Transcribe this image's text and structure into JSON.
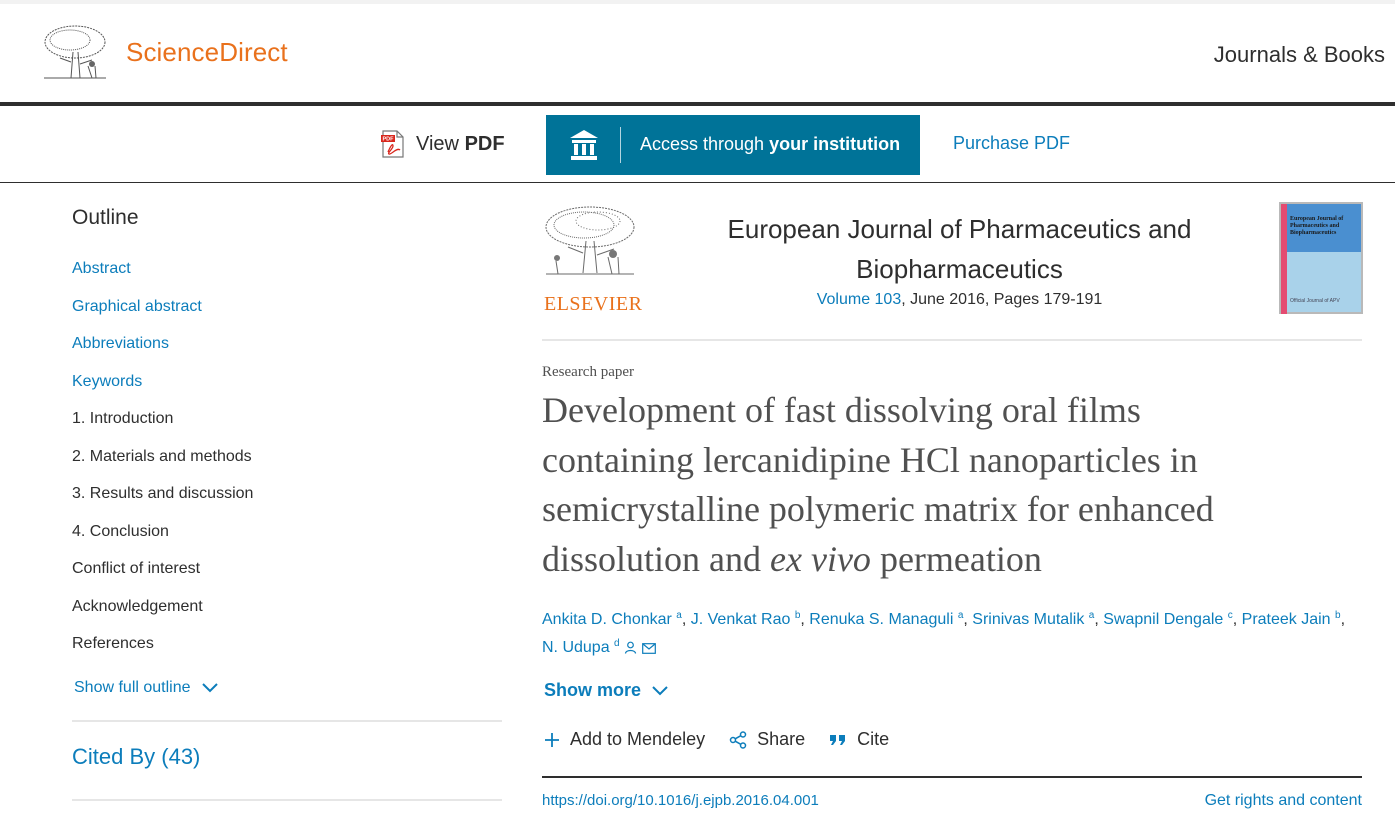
{
  "header": {
    "brand": "ScienceDirect",
    "journals_books": "Journals & Books",
    "brand_color": "#e9711c"
  },
  "toolbar": {
    "view_pdf_prefix": "View",
    "view_pdf_bold": "PDF",
    "access_prefix": "Access through",
    "access_bold": "your institution",
    "purchase": "Purchase PDF",
    "accent_color": "#007398"
  },
  "sidebar": {
    "outline_title": "Outline",
    "items": [
      {
        "label": "Abstract"
      },
      {
        "label": "Graphical abstract"
      },
      {
        "label": "Abbreviations"
      },
      {
        "label": "Keywords"
      },
      {
        "label": "1. Introduction"
      },
      {
        "label": "2. Materials and methods"
      },
      {
        "label": "3. Results and discussion"
      },
      {
        "label": "4. Conclusion"
      },
      {
        "label": "Conflict of interest"
      },
      {
        "label": "Acknowledgement"
      },
      {
        "label": "References"
      }
    ],
    "show_full_outline": "Show full outline",
    "cited_by": "Cited By (43)"
  },
  "article": {
    "publisher": "ELSEVIER",
    "journal_line1": "European Journal of Pharmaceutics and",
    "journal_line2": "Biopharmaceutics",
    "volume": "Volume 103",
    "issue_rest": ", June 2016, Pages 179-191",
    "cover_title": "European Journal of Pharmaceutics and Biopharmaceutics",
    "cover_footer": "Official Journal of APV",
    "type": "Research paper",
    "title_lines": [
      "Development of fast dissolving oral films",
      "containing lercanidipine HCl nanoparticles in",
      "semicrystalline polymeric matrix for enhanced"
    ],
    "title_last_prefix": "dissolution and",
    "title_italic": "ex vivo",
    "title_last_suffix": "permeation",
    "authors": [
      {
        "name": "Ankita D. Chonkar",
        "sup": "a"
      },
      {
        "name": "J. Venkat Rao",
        "sup": "b"
      },
      {
        "name": "Renuka S. Managuli",
        "sup": "a"
      },
      {
        "name": "Srinivas Mutalik",
        "sup": "a"
      },
      {
        "name": "Swapnil Dengale",
        "sup": "c"
      },
      {
        "name": "Prateek Jain",
        "sup": "b"
      },
      {
        "name": "N. Udupa",
        "sup": "d"
      }
    ],
    "show_more": "Show more",
    "add_mendeley": "Add to Mendeley",
    "share": "Share",
    "cite": "Cite",
    "doi": "https://doi.org/10.1016/j.ejpb.2016.04.001",
    "rights": "Get rights and content",
    "link_color": "#0c7dbb"
  }
}
